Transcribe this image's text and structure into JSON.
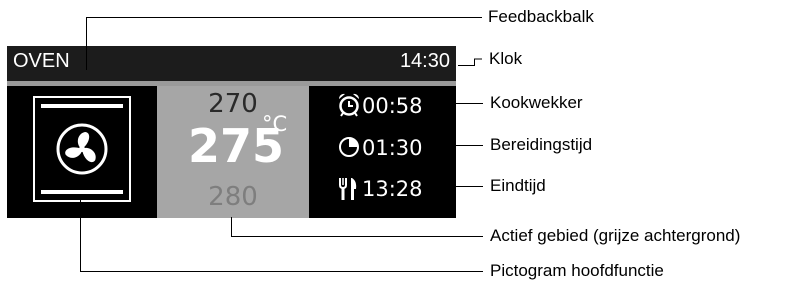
{
  "display": {
    "mode_label": "OVEN",
    "clock": "14:30",
    "temperature": {
      "previous": "270",
      "current": "275",
      "unit": "°C",
      "next": "280"
    },
    "timers": [
      {
        "icon": "alarm-clock-icon",
        "value": "00:58"
      },
      {
        "icon": "pie-timer-icon",
        "value": "01:30"
      },
      {
        "icon": "fork-knife-icon",
        "value": "13:28"
      }
    ],
    "main_function_icon": "fan-icon"
  },
  "callouts": {
    "feedback_bar": "Feedbackbalk",
    "clock": "Klok",
    "kitchen_timer": "Kookwekker",
    "cooking_time": "Bereidingstijd",
    "end_time": "Eindtijd",
    "active_area": "Actief gebied (grijze achtergrond)",
    "main_function_pictogram": "Pictogram hoofdfunctie"
  },
  "colors": {
    "bar_background": "#1c1c1c",
    "panel_background": "#000000",
    "active_background": "#a6a6a6",
    "separator": "#9a9a9a"
  }
}
